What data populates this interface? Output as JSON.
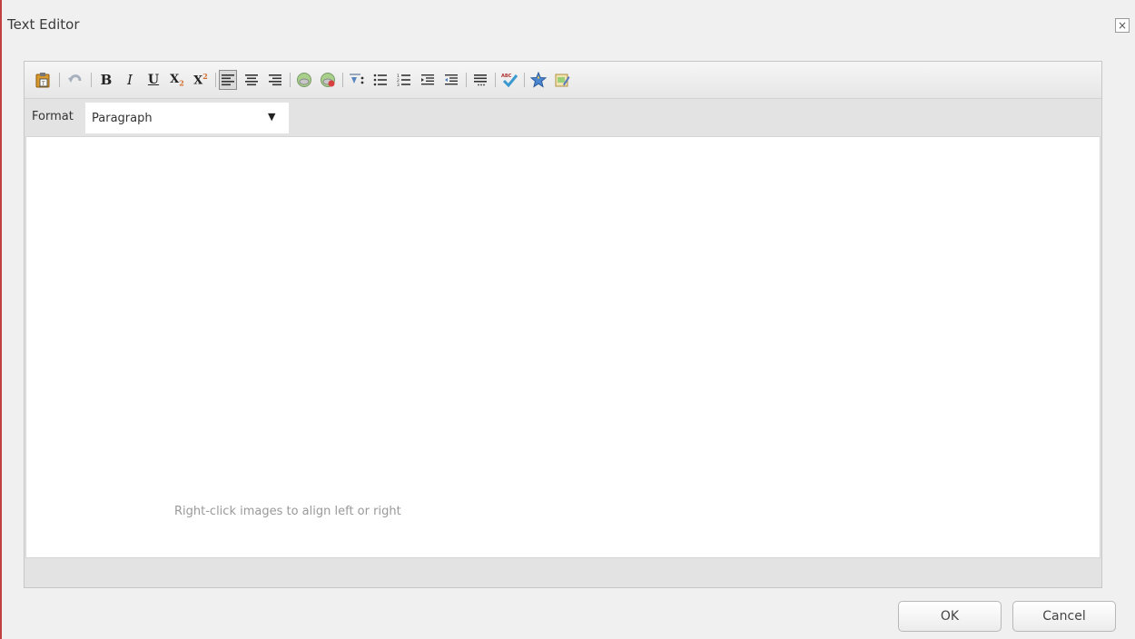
{
  "dialog": {
    "title": "Text Editor",
    "close_label": "×"
  },
  "toolbar": {
    "buttons": [
      {
        "name": "paste-icon"
      },
      {
        "name": "undo-icon"
      },
      {
        "name": "bold",
        "label": "B"
      },
      {
        "name": "italic",
        "label": "I"
      },
      {
        "name": "underline",
        "label": "U"
      },
      {
        "name": "subscript",
        "label": "X",
        "mark": "2"
      },
      {
        "name": "superscript",
        "label": "X",
        "mark": "2"
      },
      {
        "name": "align-left-icon",
        "active": true
      },
      {
        "name": "align-center-icon"
      },
      {
        "name": "align-right-icon"
      },
      {
        "name": "insert-link-icon"
      },
      {
        "name": "remove-link-icon"
      },
      {
        "name": "anchor-icon"
      },
      {
        "name": "bulleted-list-icon"
      },
      {
        "name": "numbered-list-icon"
      },
      {
        "name": "outdent-icon"
      },
      {
        "name": "indent-icon"
      },
      {
        "name": "special-characters-icon"
      },
      {
        "name": "spellcheck-icon",
        "label": "ABC"
      },
      {
        "name": "favorite-star-icon"
      },
      {
        "name": "edit-image-icon"
      }
    ]
  },
  "format": {
    "label": "Format",
    "selected": "Paragraph",
    "arrow": "▼"
  },
  "editor": {
    "content": "",
    "hint": "Right-click images to align left or right"
  },
  "footer": {
    "ok_label": "OK",
    "cancel_label": "Cancel"
  },
  "colors": {
    "accent_left_border": "#c24040",
    "dialog_background": "#f0f0f0",
    "content_background": "#ffffff",
    "hint_text": "#999999"
  }
}
